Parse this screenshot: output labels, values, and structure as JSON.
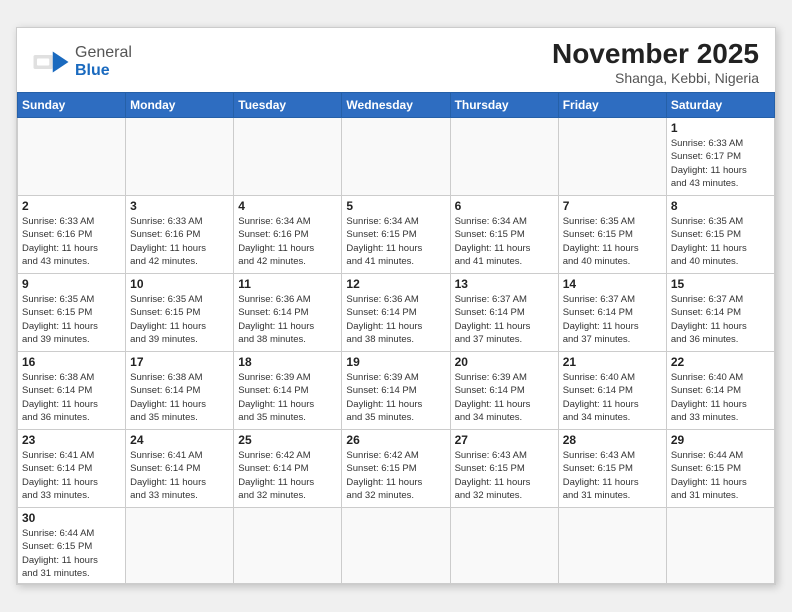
{
  "header": {
    "logo_general": "General",
    "logo_blue": "Blue",
    "month": "November 2025",
    "location": "Shanga, Kebbi, Nigeria"
  },
  "days_of_week": [
    "Sunday",
    "Monday",
    "Tuesday",
    "Wednesday",
    "Thursday",
    "Friday",
    "Saturday"
  ],
  "weeks": [
    [
      {
        "day": "",
        "info": ""
      },
      {
        "day": "",
        "info": ""
      },
      {
        "day": "",
        "info": ""
      },
      {
        "day": "",
        "info": ""
      },
      {
        "day": "",
        "info": ""
      },
      {
        "day": "",
        "info": ""
      },
      {
        "day": "1",
        "info": "Sunrise: 6:33 AM\nSunset: 6:17 PM\nDaylight: 11 hours\nand 43 minutes."
      }
    ],
    [
      {
        "day": "2",
        "info": "Sunrise: 6:33 AM\nSunset: 6:16 PM\nDaylight: 11 hours\nand 43 minutes."
      },
      {
        "day": "3",
        "info": "Sunrise: 6:33 AM\nSunset: 6:16 PM\nDaylight: 11 hours\nand 42 minutes."
      },
      {
        "day": "4",
        "info": "Sunrise: 6:34 AM\nSunset: 6:16 PM\nDaylight: 11 hours\nand 42 minutes."
      },
      {
        "day": "5",
        "info": "Sunrise: 6:34 AM\nSunset: 6:15 PM\nDaylight: 11 hours\nand 41 minutes."
      },
      {
        "day": "6",
        "info": "Sunrise: 6:34 AM\nSunset: 6:15 PM\nDaylight: 11 hours\nand 41 minutes."
      },
      {
        "day": "7",
        "info": "Sunrise: 6:35 AM\nSunset: 6:15 PM\nDaylight: 11 hours\nand 40 minutes."
      },
      {
        "day": "8",
        "info": "Sunrise: 6:35 AM\nSunset: 6:15 PM\nDaylight: 11 hours\nand 40 minutes."
      }
    ],
    [
      {
        "day": "9",
        "info": "Sunrise: 6:35 AM\nSunset: 6:15 PM\nDaylight: 11 hours\nand 39 minutes."
      },
      {
        "day": "10",
        "info": "Sunrise: 6:35 AM\nSunset: 6:15 PM\nDaylight: 11 hours\nand 39 minutes."
      },
      {
        "day": "11",
        "info": "Sunrise: 6:36 AM\nSunset: 6:14 PM\nDaylight: 11 hours\nand 38 minutes."
      },
      {
        "day": "12",
        "info": "Sunrise: 6:36 AM\nSunset: 6:14 PM\nDaylight: 11 hours\nand 38 minutes."
      },
      {
        "day": "13",
        "info": "Sunrise: 6:37 AM\nSunset: 6:14 PM\nDaylight: 11 hours\nand 37 minutes."
      },
      {
        "day": "14",
        "info": "Sunrise: 6:37 AM\nSunset: 6:14 PM\nDaylight: 11 hours\nand 37 minutes."
      },
      {
        "day": "15",
        "info": "Sunrise: 6:37 AM\nSunset: 6:14 PM\nDaylight: 11 hours\nand 36 minutes."
      }
    ],
    [
      {
        "day": "16",
        "info": "Sunrise: 6:38 AM\nSunset: 6:14 PM\nDaylight: 11 hours\nand 36 minutes."
      },
      {
        "day": "17",
        "info": "Sunrise: 6:38 AM\nSunset: 6:14 PM\nDaylight: 11 hours\nand 35 minutes."
      },
      {
        "day": "18",
        "info": "Sunrise: 6:39 AM\nSunset: 6:14 PM\nDaylight: 11 hours\nand 35 minutes."
      },
      {
        "day": "19",
        "info": "Sunrise: 6:39 AM\nSunset: 6:14 PM\nDaylight: 11 hours\nand 35 minutes."
      },
      {
        "day": "20",
        "info": "Sunrise: 6:39 AM\nSunset: 6:14 PM\nDaylight: 11 hours\nand 34 minutes."
      },
      {
        "day": "21",
        "info": "Sunrise: 6:40 AM\nSunset: 6:14 PM\nDaylight: 11 hours\nand 34 minutes."
      },
      {
        "day": "22",
        "info": "Sunrise: 6:40 AM\nSunset: 6:14 PM\nDaylight: 11 hours\nand 33 minutes."
      }
    ],
    [
      {
        "day": "23",
        "info": "Sunrise: 6:41 AM\nSunset: 6:14 PM\nDaylight: 11 hours\nand 33 minutes."
      },
      {
        "day": "24",
        "info": "Sunrise: 6:41 AM\nSunset: 6:14 PM\nDaylight: 11 hours\nand 33 minutes."
      },
      {
        "day": "25",
        "info": "Sunrise: 6:42 AM\nSunset: 6:14 PM\nDaylight: 11 hours\nand 32 minutes."
      },
      {
        "day": "26",
        "info": "Sunrise: 6:42 AM\nSunset: 6:15 PM\nDaylight: 11 hours\nand 32 minutes."
      },
      {
        "day": "27",
        "info": "Sunrise: 6:43 AM\nSunset: 6:15 PM\nDaylight: 11 hours\nand 32 minutes."
      },
      {
        "day": "28",
        "info": "Sunrise: 6:43 AM\nSunset: 6:15 PM\nDaylight: 11 hours\nand 31 minutes."
      },
      {
        "day": "29",
        "info": "Sunrise: 6:44 AM\nSunset: 6:15 PM\nDaylight: 11 hours\nand 31 minutes."
      }
    ],
    [
      {
        "day": "30",
        "info": "Sunrise: 6:44 AM\nSunset: 6:15 PM\nDaylight: 11 hours\nand 31 minutes."
      },
      {
        "day": "",
        "info": ""
      },
      {
        "day": "",
        "info": ""
      },
      {
        "day": "",
        "info": ""
      },
      {
        "day": "",
        "info": ""
      },
      {
        "day": "",
        "info": ""
      },
      {
        "day": "",
        "info": ""
      }
    ]
  ]
}
